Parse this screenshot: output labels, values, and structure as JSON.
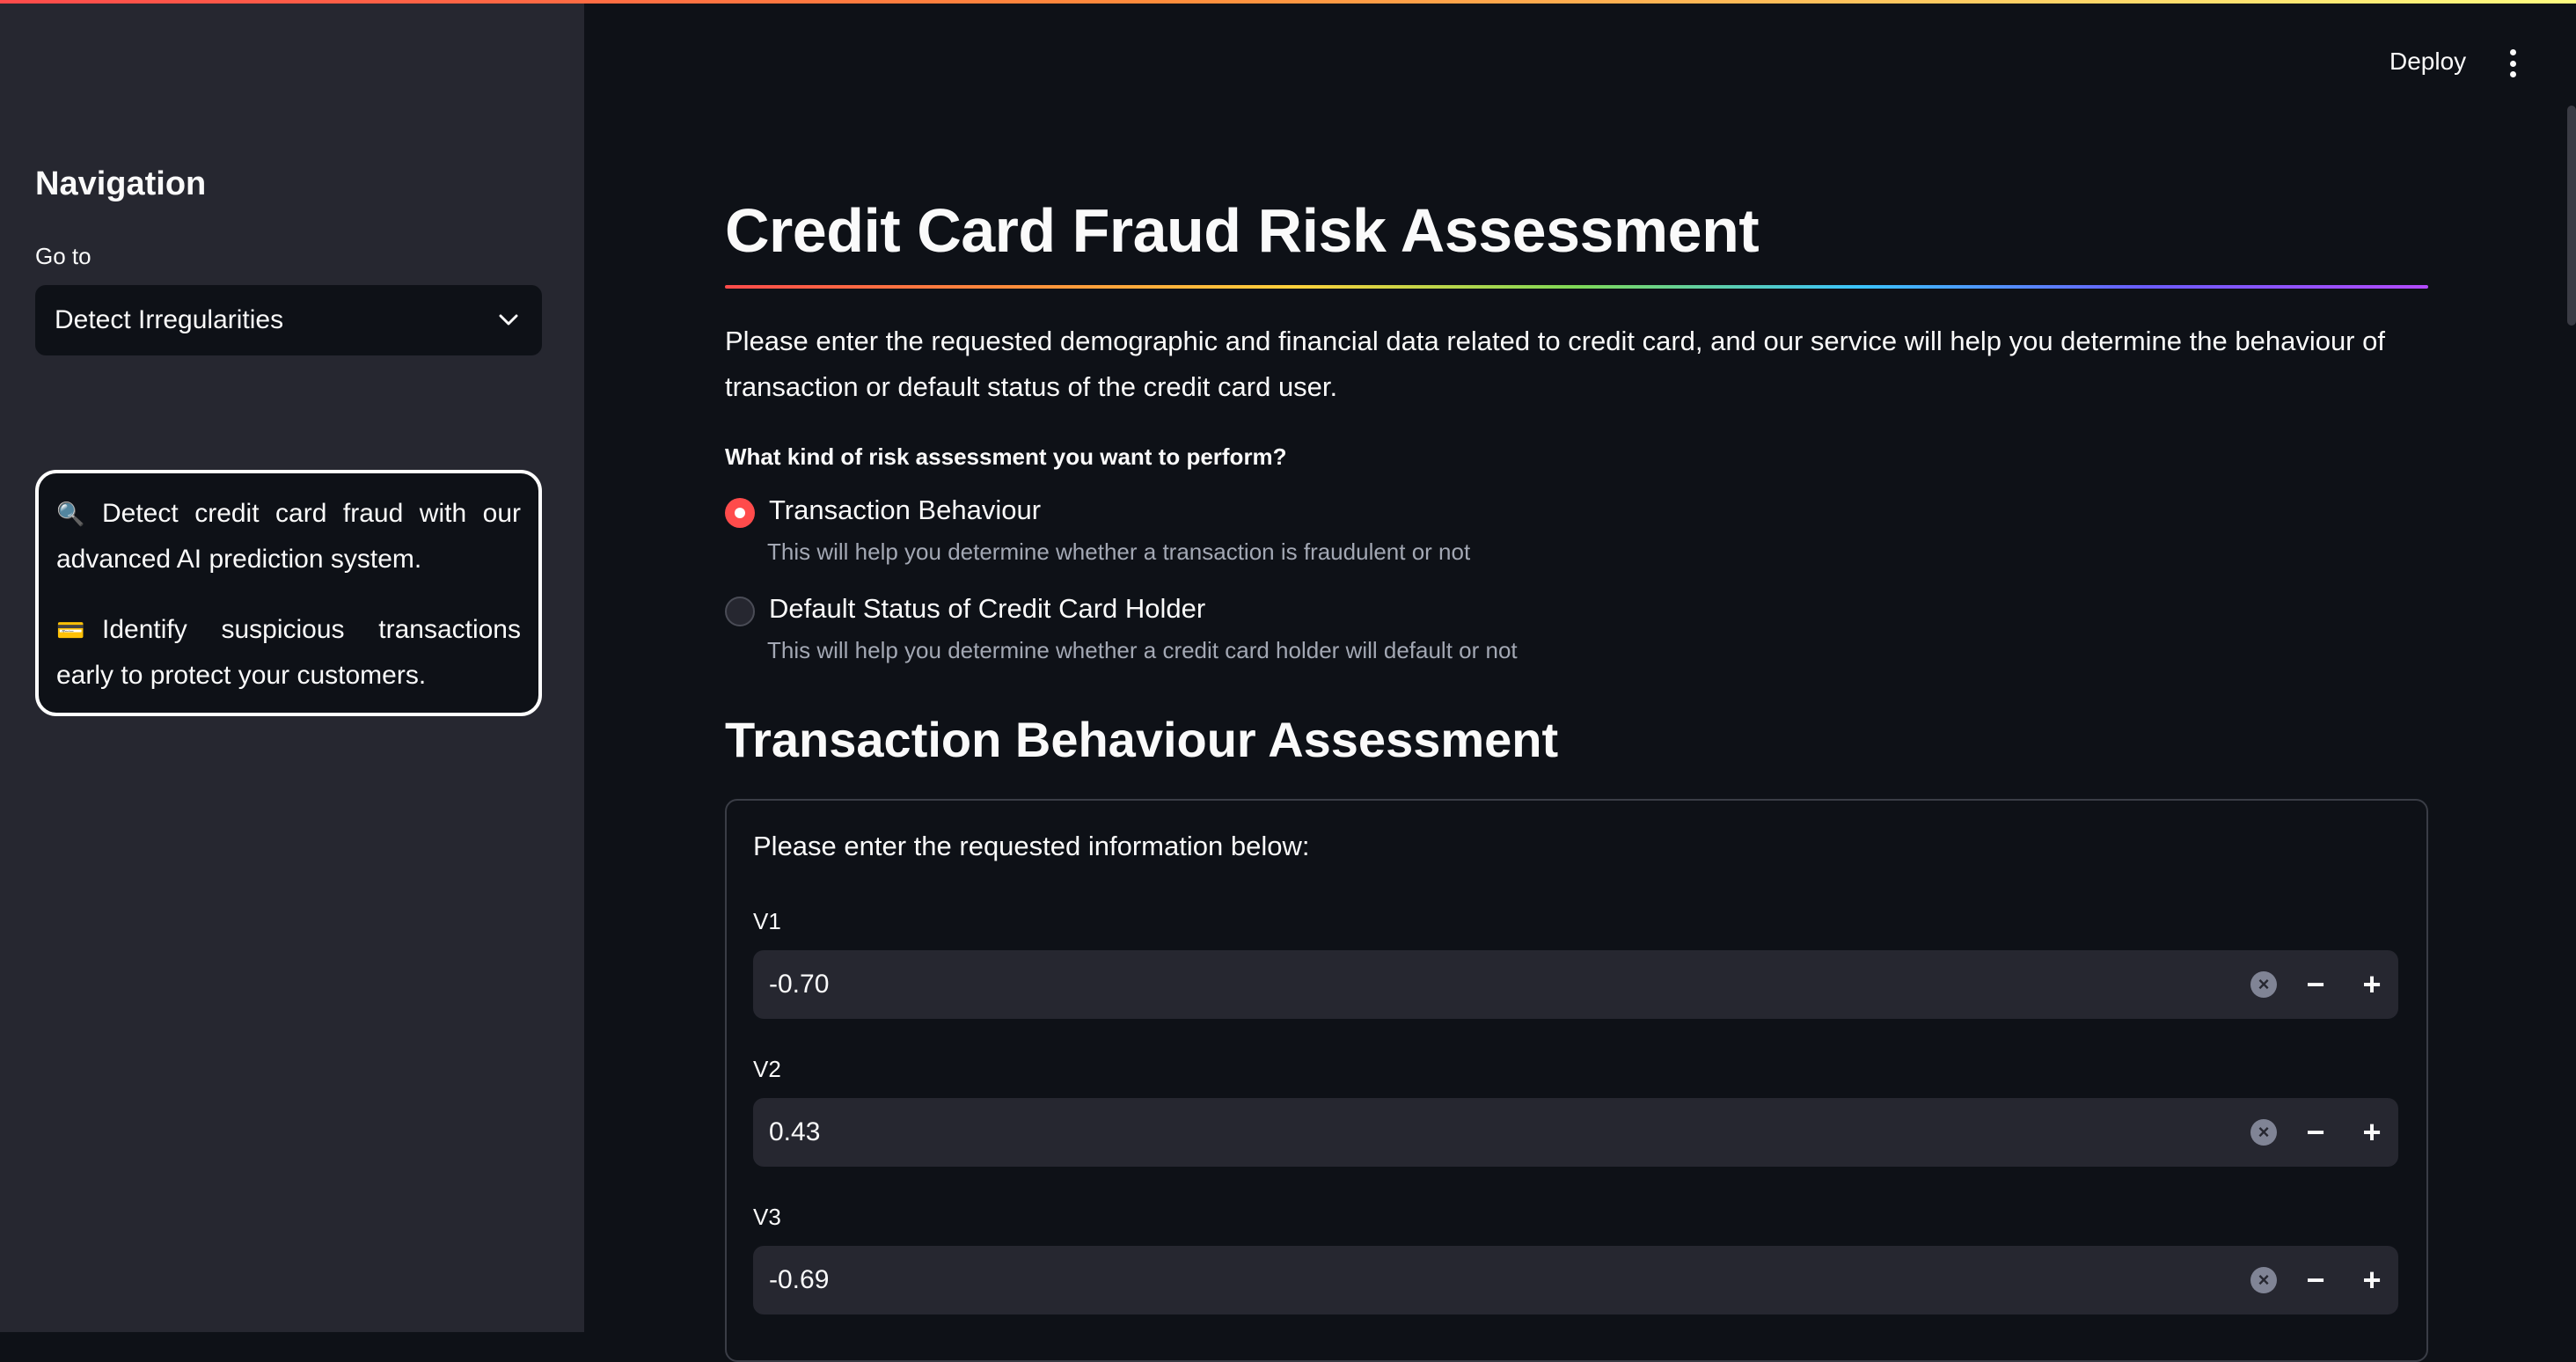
{
  "sidebar": {
    "nav_title": "Navigation",
    "goto_label": "Go to",
    "selected_page": "Detect Irregularities",
    "info": [
      {
        "icon": "magnifier-icon",
        "emoji": "🔍",
        "text": "Detect credit card fraud with our advanced AI prediction system."
      },
      {
        "icon": "credit-card-icon",
        "emoji": "💳",
        "text": "Identify suspicious transactions early to protect your customers."
      }
    ]
  },
  "header": {
    "deploy_label": "Deploy",
    "menu_icon": "kebab-menu-icon"
  },
  "main": {
    "title": "Credit Card Fraud Risk Assessment",
    "intro": "Please enter the requested demographic and financial data related to credit card, and our service will help you determine the behaviour of transaction or default status of the credit card user.",
    "question": "What kind of risk assessment you want to perform?",
    "options": [
      {
        "label": "Transaction Behaviour",
        "help": "This will help you determine whether a transaction is fraudulent or not",
        "selected": true
      },
      {
        "label": "Default Status of Credit Card Holder",
        "help": "This will help you determine whether a credit card holder will default or not",
        "selected": false
      }
    ],
    "section_title": "Transaction Behaviour Assessment",
    "form_intro": "Please enter the requested information below:",
    "fields": [
      {
        "label": "V1",
        "value": "-0.70"
      },
      {
        "label": "V2",
        "value": "0.43"
      },
      {
        "label": "V3",
        "value": "-0.69"
      }
    ]
  },
  "colors": {
    "background": "#0e1117",
    "sidebar": "#262730",
    "accent": "#ff4b4b",
    "input": "#262730"
  }
}
